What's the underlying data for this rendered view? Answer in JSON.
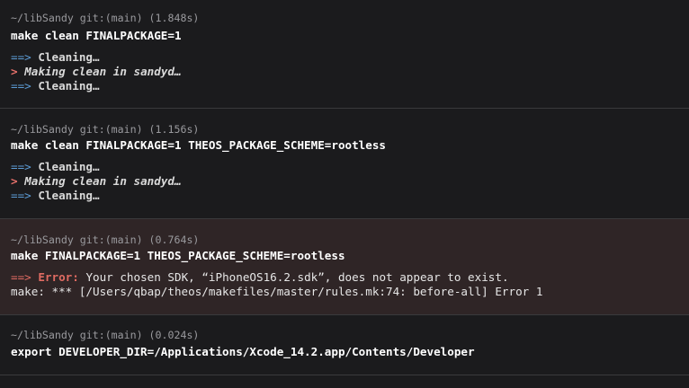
{
  "blocks": [
    {
      "prompt": "~/libSandy git:(main) (1.848s)",
      "command": "make clean FINALPACKAGE=1",
      "output": [
        {
          "prefix": "==>",
          "text": "Cleaning…"
        },
        {
          "prefix": ">",
          "text": "Making clean in sandyd…"
        },
        {
          "prefix": "==>",
          "text": "Cleaning…"
        }
      ]
    },
    {
      "prompt": "~/libSandy git:(main) (1.156s)",
      "command": "make clean FINALPACKAGE=1 THEOS_PACKAGE_SCHEME=rootless",
      "output": [
        {
          "prefix": "==>",
          "text": "Cleaning…"
        },
        {
          "prefix": ">",
          "text": "Making clean in sandyd…"
        },
        {
          "prefix": "==>",
          "text": "Cleaning…"
        }
      ]
    },
    {
      "prompt": "~/libSandy git:(main) (0.764s)",
      "command": "make FINALPACKAGE=1 THEOS_PACKAGE_SCHEME=rootless",
      "error_prefix": "==>",
      "error_label": "Error:",
      "error_text": "Your chosen SDK, “iPhoneOS16.2.sdk”, does not appear to exist.",
      "make_line": "make: *** [/Users/qbap/theos/makefiles/master/rules.mk:74: before-all] Error 1"
    },
    {
      "prompt": "~/libSandy git:(main) (0.024s)",
      "command": "export DEVELOPER_DIR=/Applications/Xcode_14.2.app/Contents/Developer"
    }
  ]
}
